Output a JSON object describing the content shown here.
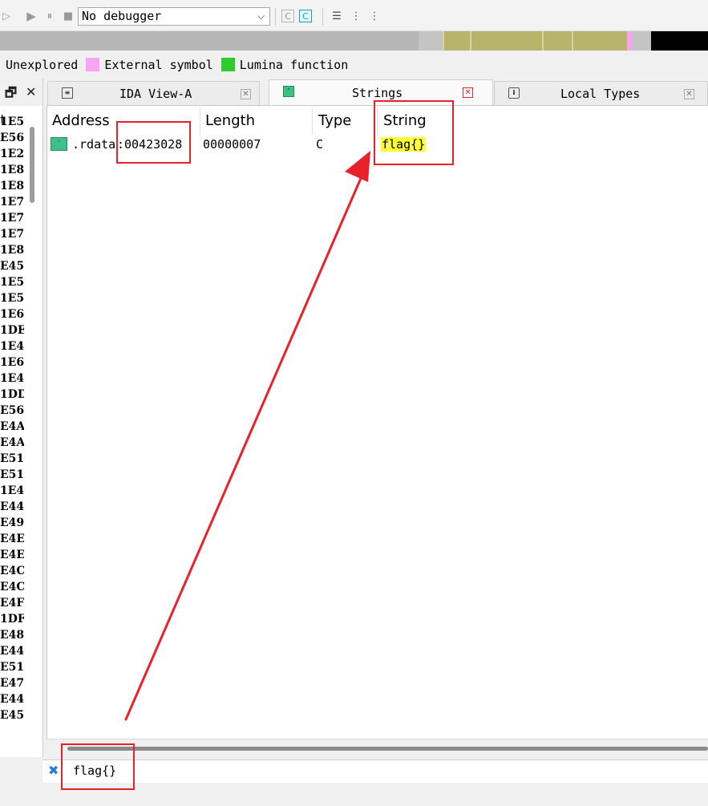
{
  "toolbar": {
    "debugger_label": "No debugger",
    "colors": {
      "icon_gray": "#9a9a9a",
      "active_cyan": "#1aa3b0"
    }
  },
  "navband": {
    "colors": {
      "gray": "#b6b6b6",
      "olive": "#b8b46c",
      "pink": "#f9a3f3",
      "black": "#000000"
    }
  },
  "legend": {
    "items": [
      {
        "label": "Unexplored",
        "color": ""
      },
      {
        "label": "External symbol",
        "color": "#f9a3f3"
      },
      {
        "label": "Lumina function",
        "color": "#2ecc2e"
      }
    ]
  },
  "left_panel": {
    "column_header": "t",
    "rows": [
      "1E5",
      "E56",
      "1E2",
      "1E8",
      "1E8",
      "1E7",
      "1E7",
      "1E7",
      "1E8",
      "E45",
      "1E5",
      "1E5",
      "1E6",
      "1DE",
      "1E4",
      "1E6",
      "1E4",
      "1DD",
      "E56",
      "E4A",
      "E4A",
      "E51",
      "E51",
      "1E4",
      "E44",
      "E49",
      "E4E",
      "E4E",
      "E4C",
      "E4C",
      "E4F",
      "1DF",
      "E48",
      "E44",
      "E51",
      "E47",
      "E44",
      "E45"
    ]
  },
  "tabs": [
    {
      "label": "IDA View-A",
      "icon": "listing-icon",
      "active": false
    },
    {
      "label": "Strings",
      "icon": "strings-icon",
      "active": true
    },
    {
      "label": "Local Types",
      "icon": "info-icon",
      "active": false
    }
  ],
  "strings_table": {
    "columns": [
      "Address",
      "Length",
      "Type",
      "String"
    ],
    "rows": [
      {
        "segment": ".rdata",
        "address": "00423028",
        "length": "00000007",
        "type": "C",
        "string": "flag{}"
      }
    ]
  },
  "filter": {
    "value": "flag{}"
  },
  "annotation": {
    "color": "#e8212b"
  }
}
